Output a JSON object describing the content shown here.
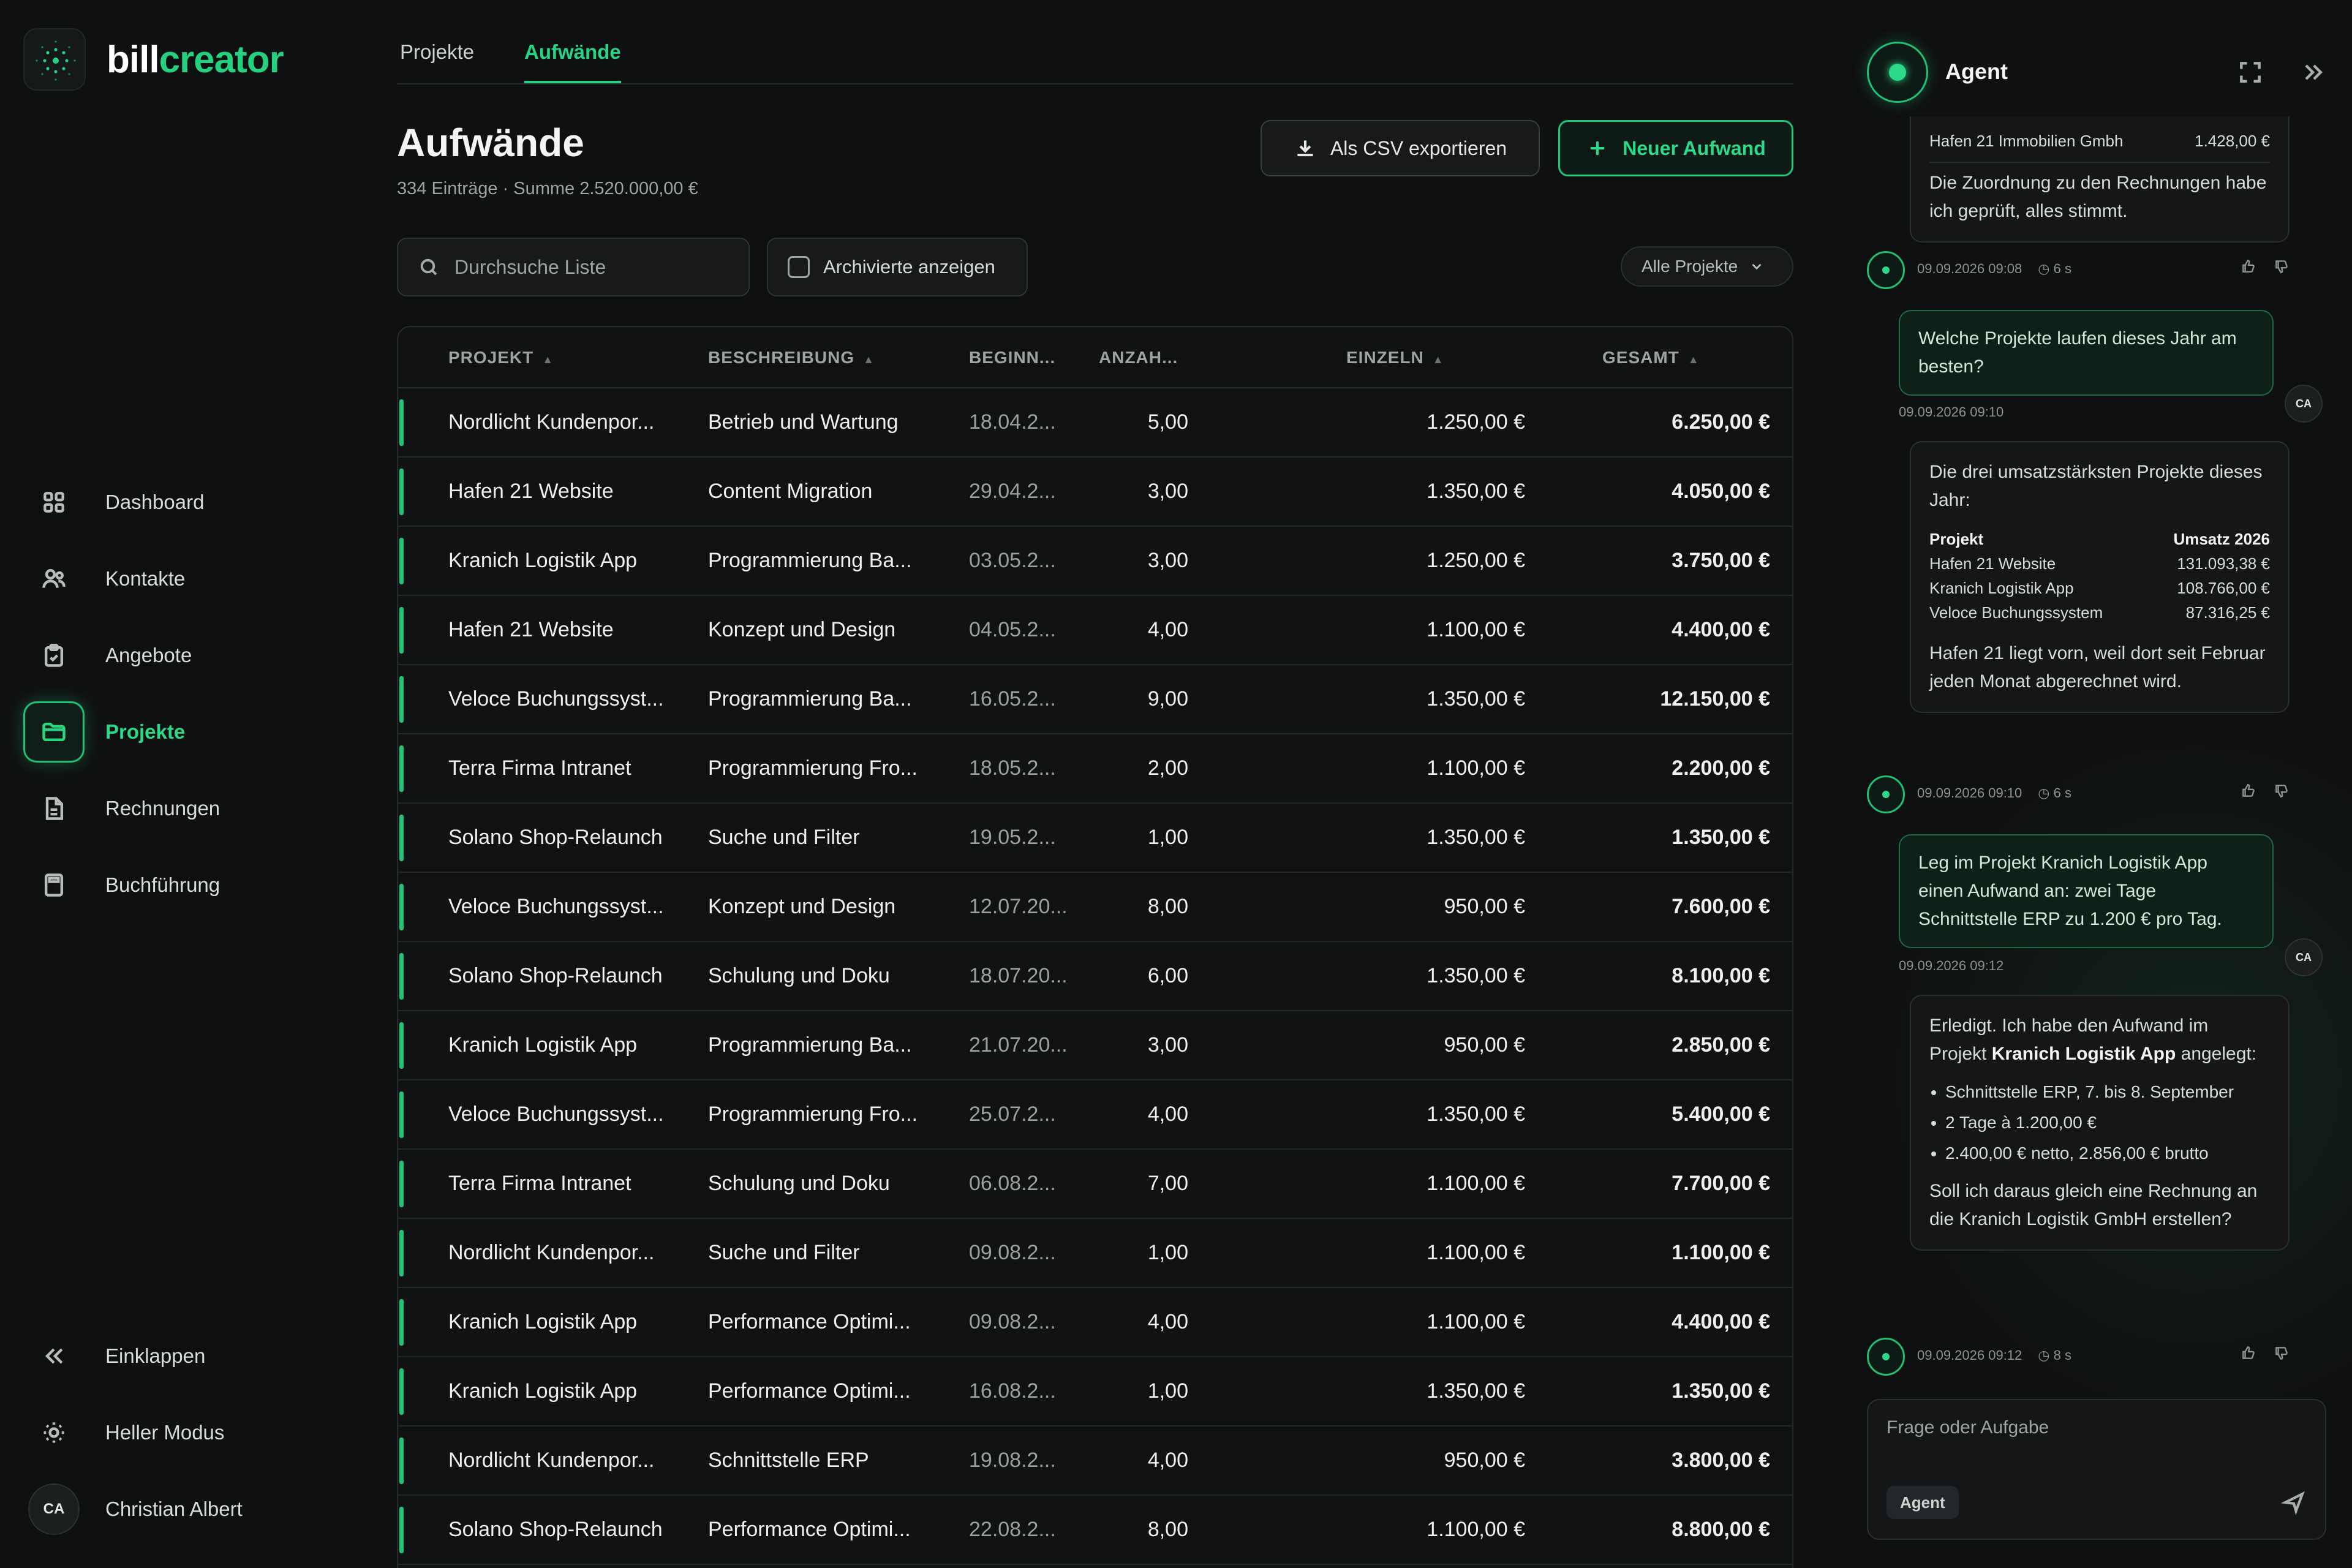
{
  "brand": {
    "part1": "bill",
    "part2": "creator",
    "accent": "#25d07f"
  },
  "sidebar": {
    "items": [
      {
        "label": "Dashboard",
        "icon": "grid-icon"
      },
      {
        "label": "Kontakte",
        "icon": "users-icon"
      },
      {
        "label": "Angebote",
        "icon": "clipboard-icon"
      },
      {
        "label": "Projekte",
        "icon": "folder-icon",
        "active": true
      },
      {
        "label": "Rechnungen",
        "icon": "document-icon"
      },
      {
        "label": "Buchführung",
        "icon": "calculator-icon"
      }
    ],
    "collapse_label": "Einklappen",
    "theme_label": "Heller Modus",
    "user_initials": "CA",
    "user_name": "Christian Albert"
  },
  "tabs": [
    {
      "label": "Projekte"
    },
    {
      "label": "Aufwände",
      "active": true
    }
  ],
  "page": {
    "title": "Aufwände",
    "subtitle": "334 Einträge · Summe 2.520.000,00 €",
    "export_label": "Als CSV exportieren",
    "new_label": "Neuer Aufwand",
    "search_placeholder": "Durchsuche Liste",
    "archive_label": "Archivierte anzeigen",
    "filter_label": "Alle Projekte"
  },
  "table": {
    "headers": {
      "projekt": "PROJEKT",
      "beschreibung": "BESCHREIBUNG",
      "beginn": "BEGINN...",
      "anzahl": "ANZAH...",
      "einzeln": "EINZELN",
      "gesamt": "GESAMT"
    },
    "rows": [
      [
        "Nordlicht Kundenpor...",
        "Betrieb und Wartung",
        "18.04.2...",
        "5,00",
        "1.250,00 €",
        "6.250,00 €"
      ],
      [
        "Hafen 21 Website",
        "Content Migration",
        "29.04.2...",
        "3,00",
        "1.350,00 €",
        "4.050,00 €"
      ],
      [
        "Kranich Logistik App",
        "Programmierung Ba...",
        "03.05.2...",
        "3,00",
        "1.250,00 €",
        "3.750,00 €"
      ],
      [
        "Hafen 21 Website",
        "Konzept und Design",
        "04.05.2...",
        "4,00",
        "1.100,00 €",
        "4.400,00 €"
      ],
      [
        "Veloce Buchungssyst...",
        "Programmierung Ba...",
        "16.05.2...",
        "9,00",
        "1.350,00 €",
        "12.150,00 €"
      ],
      [
        "Terra Firma Intranet",
        "Programmierung Fro...",
        "18.05.2...",
        "2,00",
        "1.100,00 €",
        "2.200,00 €"
      ],
      [
        "Solano Shop-Relaunch",
        "Suche und Filter",
        "19.05.2...",
        "1,00",
        "1.350,00 €",
        "1.350,00 €"
      ],
      [
        "Veloce Buchungssyst...",
        "Konzept und Design",
        "12.07.20...",
        "8,00",
        "950,00 €",
        "7.600,00 €"
      ],
      [
        "Solano Shop-Relaunch",
        "Schulung und Doku",
        "18.07.20...",
        "6,00",
        "1.350,00 €",
        "8.100,00 €"
      ],
      [
        "Kranich Logistik App",
        "Programmierung Ba...",
        "21.07.20...",
        "3,00",
        "950,00 €",
        "2.850,00 €"
      ],
      [
        "Veloce Buchungssyst...",
        "Programmierung Fro...",
        "25.07.2...",
        "4,00",
        "1.350,00 €",
        "5.400,00 €"
      ],
      [
        "Terra Firma Intranet",
        "Schulung und Doku",
        "06.08.2...",
        "7,00",
        "1.100,00 €",
        "7.700,00 €"
      ],
      [
        "Nordlicht Kundenpor...",
        "Suche und Filter",
        "09.08.2...",
        "1,00",
        "1.100,00 €",
        "1.100,00 €"
      ],
      [
        "Kranich Logistik App",
        "Performance Optimi...",
        "09.08.2...",
        "4,00",
        "1.100,00 €",
        "4.400,00 €"
      ],
      [
        "Kranich Logistik App",
        "Performance Optimi...",
        "16.08.2...",
        "1,00",
        "1.350,00 €",
        "1.350,00 €"
      ],
      [
        "Nordlicht Kundenpor...",
        "Schnittstelle ERP",
        "19.08.2...",
        "4,00",
        "950,00 €",
        "3.800,00 €"
      ],
      [
        "Solano Shop-Relaunch",
        "Performance Optimi...",
        "22.08.2...",
        "8,00",
        "1.100,00 €",
        "8.800,00 €"
      ]
    ]
  },
  "agent": {
    "title": "Agent",
    "msg1": {
      "row_name": "Hafen 21 Immobilien Gmbh",
      "row_value": "1.428,00 €",
      "text": "Die Zuordnung zu den Rechnungen habe ich geprüft, alles stimmt.",
      "time": "09.09.2026 09:08",
      "duration": "6 s"
    },
    "user1": {
      "text": "Welche Projekte laufen dieses Jahr am besten?",
      "time": "09.09.2026 09:10",
      "initials": "CA"
    },
    "msg2": {
      "intro": "Die drei umsatzstärksten Projekte dieses Jahr:",
      "col1": "Projekt",
      "col2": "Umsatz 2026",
      "rows": [
        [
          "Hafen 21 Website",
          "131.093,38 €"
        ],
        [
          "Kranich Logistik App",
          "108.766,00 €"
        ],
        [
          "Veloce Buchungssystem",
          "87.316,25 €"
        ]
      ],
      "outro": "Hafen 21 liegt vorn, weil dort seit Februar jeden Monat abgerechnet wird.",
      "time": "09.09.2026 09:10",
      "duration": "6 s"
    },
    "user2": {
      "text": "Leg im Projekt Kranich Logistik App einen Aufwand an: zwei Tage Schnittstelle ERP zu 1.200 € pro Tag.",
      "time": "09.09.2026 09:12",
      "initials": "CA"
    },
    "msg3": {
      "intro_a": "Erledigt. Ich habe den Aufwand im Projekt ",
      "intro_bold": "Kranich Logistik App",
      "intro_b": " angelegt:",
      "bullets": [
        "Schnittstelle ERP, 7. bis 8. September",
        "2 Tage à 1.200,00 €",
        "2.400,00 € netto, 2.856,00 € brutto"
      ],
      "outro": "Soll ich daraus gleich eine Rechnung an die Kranich Logistik GmbH erstellen?",
      "time": "09.09.2026 09:12",
      "duration": "8 s"
    },
    "input_placeholder": "Frage oder Aufgabe",
    "mode_label": "Agent"
  }
}
